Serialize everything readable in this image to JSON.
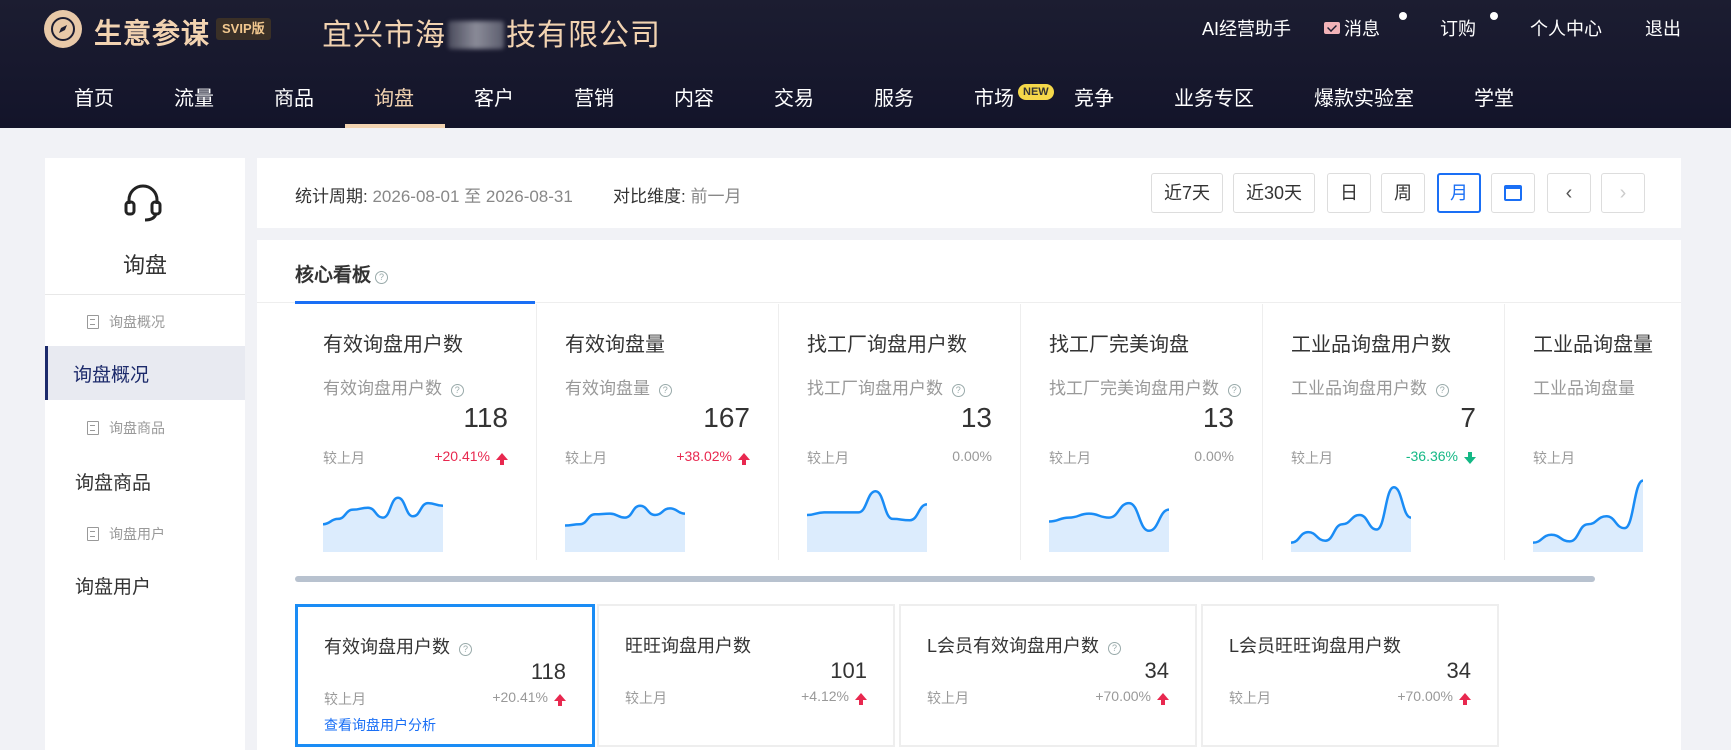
{
  "header": {
    "brand": "生意参谋",
    "edition": "SVIP版",
    "company_prefix": "宜兴市海",
    "company_suffix": "技有限公司",
    "links": {
      "ai": "AI经营助手",
      "messages": "消息",
      "orders": "订购",
      "profile": "个人中心",
      "logout": "退出"
    }
  },
  "nav": {
    "items": [
      "首页",
      "流量",
      "商品",
      "询盘",
      "客户",
      "营销",
      "内容",
      "交易",
      "服务",
      "市场",
      "竞争",
      "业务专区",
      "爆款实验室",
      "学堂"
    ],
    "active": "询盘",
    "new_badge": "NEW"
  },
  "sidebar": {
    "title": "询盘",
    "entries": [
      {
        "type": "sub",
        "label": "询盘概况"
      },
      {
        "type": "main",
        "label": "询盘概况",
        "active": true
      },
      {
        "type": "sub",
        "label": "询盘商品"
      },
      {
        "type": "main",
        "label": "询盘商品"
      },
      {
        "type": "sub",
        "label": "询盘用户"
      },
      {
        "type": "main",
        "label": "询盘用户"
      }
    ]
  },
  "period": {
    "label": "统计周期:",
    "range": "2026-08-01 至 2026-08-31",
    "compare_label": "对比维度:",
    "compare_value": "前一月",
    "buttons": [
      "近7天",
      "近30天",
      "日",
      "周",
      "月"
    ],
    "active_button": "月"
  },
  "board": {
    "title": "核心看板",
    "compare_label": "较上月",
    "metrics": [
      {
        "title": "有效询盘用户数",
        "sub": "有效询盘用户数",
        "value": "118",
        "change": "+20.41%",
        "trend": "up",
        "spark": [
          30,
          38,
          52,
          55,
          40,
          70,
          42,
          62,
          58
        ]
      },
      {
        "title": "有效询盘量",
        "sub": "有效询盘量",
        "value": "167",
        "change": "+38.02%",
        "trend": "up",
        "spark": [
          28,
          30,
          45,
          46,
          40,
          58,
          44,
          54,
          46
        ]
      },
      {
        "title": "找工厂询盘用户数",
        "sub": "找工厂询盘用户数",
        "value": "13",
        "change": "0.00%",
        "trend": "flat",
        "spark": [
          44,
          48,
          48,
          48,
          80,
          38,
          36,
          60
        ]
      },
      {
        "title": "找工厂完美询盘",
        "sub": "找工厂完美询盘用户数",
        "value": "13",
        "change": "0.00%",
        "trend": "flat",
        "spark": [
          34,
          40,
          46,
          40,
          62,
          20,
          52
        ]
      },
      {
        "title": "工业品询盘用户数",
        "sub": "工业品询盘用户数",
        "value": "7",
        "change": "-36.36%",
        "trend": "down",
        "spark": [
          2,
          18,
          5,
          30,
          44,
          22,
          86,
          40
        ]
      },
      {
        "title": "工业品询盘量",
        "sub": "工业品询盘量",
        "value": "",
        "change": "",
        "trend": "flat",
        "spark": [
          2,
          14,
          4,
          30,
          42,
          24,
          96
        ]
      }
    ],
    "cards": [
      {
        "title": "有效询盘用户数",
        "help": true,
        "value": "118",
        "change": "+20.41%",
        "link": "查看询盘用户分析",
        "active": true
      },
      {
        "title": "旺旺询盘用户数",
        "help": false,
        "value": "101",
        "change": "+4.12%",
        "link": "",
        "active": false
      },
      {
        "title": "L会员有效询盘用户数",
        "help": true,
        "value": "34",
        "change": "+70.00%",
        "link": "",
        "active": false
      },
      {
        "title": "L会员旺旺询盘用户数",
        "help": false,
        "value": "34",
        "change": "+70.00%",
        "link": "",
        "active": false
      }
    ]
  }
}
